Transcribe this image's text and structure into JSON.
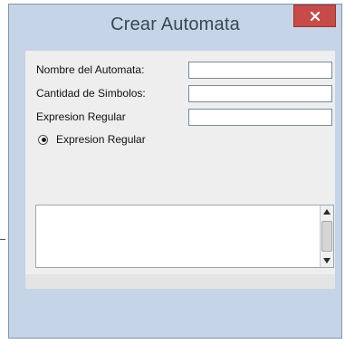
{
  "window": {
    "title": "Crear Automata",
    "close_icon": "close-x-icon",
    "accent": "#c74b49",
    "frame_color": "#c5d4e6"
  },
  "form": {
    "fields": [
      {
        "label": "Nombre del Automata:",
        "value": "",
        "placeholder": ""
      },
      {
        "label": "Cantidad de Simbolos:",
        "value": "",
        "placeholder": ""
      },
      {
        "label": "Expresion Regular",
        "value": "",
        "placeholder": ""
      }
    ],
    "radio": {
      "label": "Expresion Regular",
      "selected": true
    }
  },
  "output": {
    "text": "",
    "scroll_up_icon": "arrow-up-icon",
    "scroll_down_icon": "arrow-down-icon"
  }
}
